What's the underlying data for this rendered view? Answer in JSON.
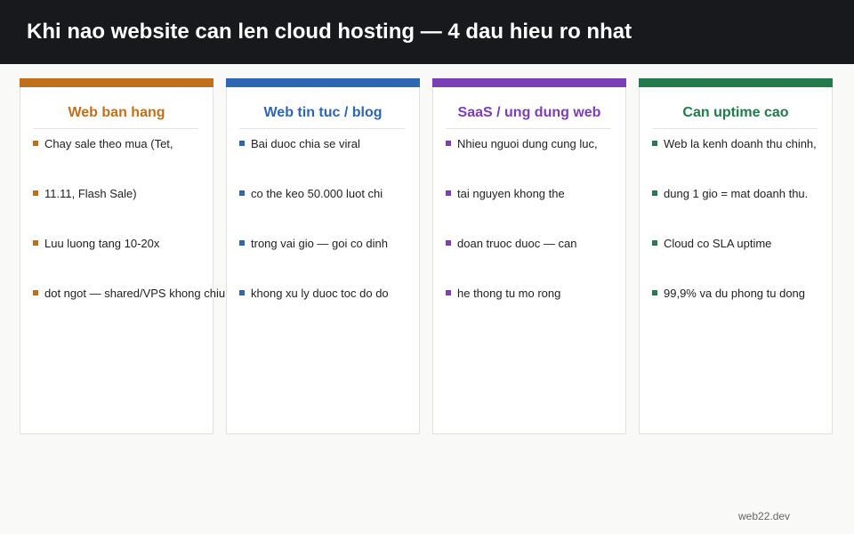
{
  "header": {
    "title": "Khi nao website can len cloud hosting — 4 dau hieu ro nhat"
  },
  "cards": [
    {
      "title": "Web ban hang",
      "accent": "#c0701a",
      "items": [
        "Chay sale theo mua (Tet,",
        "11.11, Flash Sale)",
        "Luu luong tang 10-20x",
        "dot ngot — shared/VPS khong chiu"
      ]
    },
    {
      "title": "Web tin tuc / blog",
      "accent": "#2f66b3",
      "items": [
        "Bai duoc chia se viral",
        "co the keo 50.000 luot chi",
        "trong vai gio — goi co dinh",
        "khong xu ly duoc toc do do"
      ]
    },
    {
      "title": "SaaS / ung dung web",
      "accent": "#7b3fb5",
      "items": [
        "Nhieu nguoi dung cung luc,",
        "tai nguyen khong the",
        "doan truoc duoc — can",
        "he thong tu mo rong"
      ]
    },
    {
      "title": "Can uptime cao",
      "accent": "#237a4a",
      "items": [
        "Web la kenh doanh thu chinh,",
        "dung 1 gio = mat doanh thu.",
        "Cloud co SLA uptime",
        "99,9% va du phong tu dong"
      ]
    }
  ],
  "footer": {
    "text": "web22.dev"
  }
}
